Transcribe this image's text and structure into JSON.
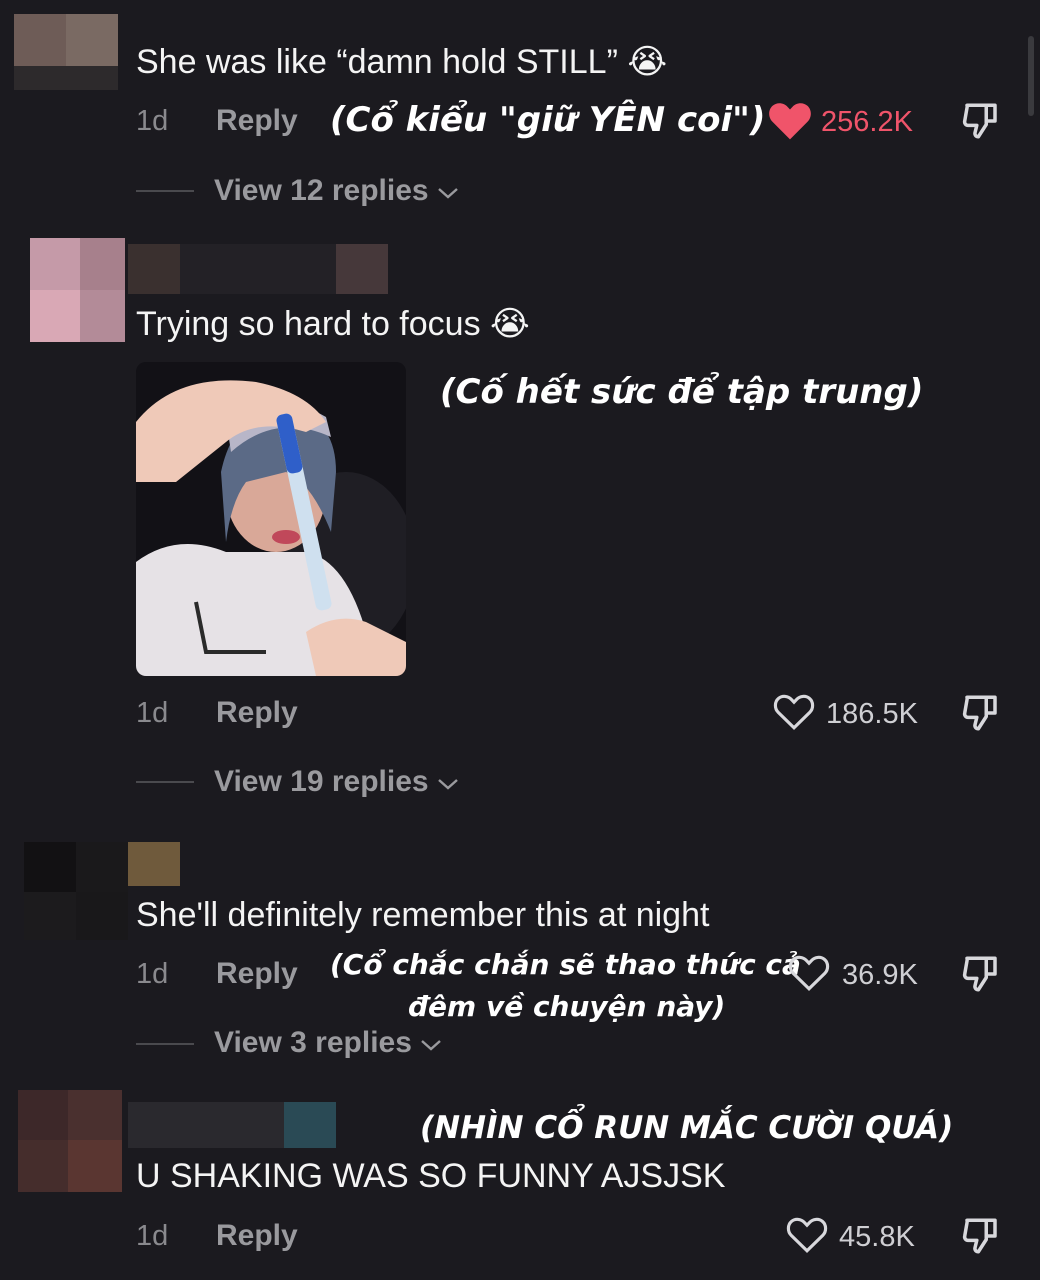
{
  "comments": [
    {
      "text": "She was like “damn hold STILL” ",
      "emoji": "😭",
      "time": "1d",
      "reply_label": "Reply",
      "likes": "256.2K",
      "liked": true,
      "translation": "(Cổ kiểu \"giữ YÊN coi\")",
      "view_replies": "View 12 replies"
    },
    {
      "text": "Trying so hard to focus ",
      "emoji": "😭",
      "time": "1d",
      "reply_label": "Reply",
      "likes": "186.5K",
      "liked": false,
      "translation": "(Cố hết sức để tập trung)",
      "view_replies": "View 19 replies"
    },
    {
      "text": "She'll definitely remember this at night",
      "time": "1d",
      "reply_label": "Reply",
      "likes": "36.9K",
      "liked": false,
      "translation_line1": "(Cổ chắc chắn sẽ thao thức cả",
      "translation_line2": "đêm về chuyện này)",
      "view_replies": "View 3 replies"
    },
    {
      "text": "U SHAKING WAS SO FUNNY AJSJSK",
      "time": "1d",
      "reply_label": "Reply",
      "likes": "45.8K",
      "liked": false,
      "translation": "(NHÌN CỔ RUN MẮC CƯỜI QUÁ)"
    }
  ],
  "icons": {
    "like_filled": "heart-filled-icon",
    "like_outline": "heart-outline-icon",
    "dislike": "thumbs-down-icon",
    "expand": "chevron-down-icon"
  },
  "colors": {
    "background": "#1b1a1f",
    "liked": "#f0546a"
  }
}
